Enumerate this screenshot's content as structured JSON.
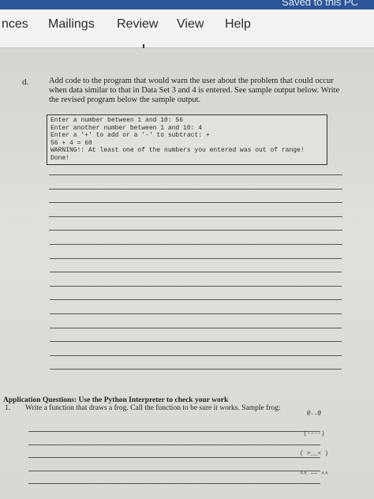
{
  "window": {
    "save_status": "Saved to this PC"
  },
  "ribbon": {
    "tabs": [
      "nces",
      "Mailings",
      "Review",
      "View",
      "Help"
    ]
  },
  "document": {
    "question_letter": "d.",
    "question_lines": [
      "Add code to the program that would warn the user about the problem that could occur",
      "when data similar to that in Data Set 3 and 4 is entered. See sample output below. Write",
      "the revised program below the sample output."
    ],
    "code_lines": [
      "Enter a number between 1 and 10: 56",
      "Enter another number between 1 and 10: 4",
      "Enter a '+' to add or a '-' to subtract: +",
      "56 + 4 = 60",
      "WARNING!: At least one of the numbers you entered was out of range!",
      "Done!"
    ],
    "application_heading": "Application Questions: Use the Python Interpreter to check your work",
    "item_number": "1.",
    "item_text": "Write a function that draws a frog. Call the function to be sure it works. Sample frog:",
    "frog_lines": [
      "  @..@",
      " (----)",
      "( >__< )",
      "^^ ~~ ^^"
    ]
  }
}
